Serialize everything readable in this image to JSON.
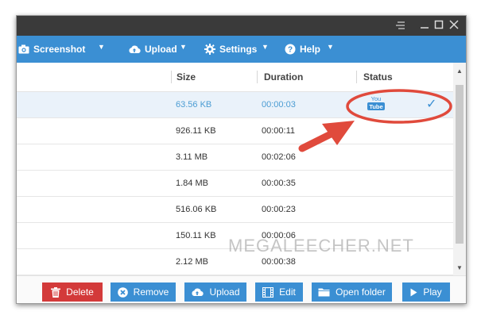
{
  "menubar": {
    "screenshot_label": "Screenshot",
    "upload_label": "Upload",
    "settings_label": "Settings",
    "help_label": "Help"
  },
  "table": {
    "headers": {
      "size": "Size",
      "duration": "Duration",
      "status": "Status"
    },
    "rows": [
      {
        "size": "63.56 KB",
        "duration": "00:00:03",
        "status_icon": "youtube-icon",
        "status_check": "✓"
      },
      {
        "size": "926.11 KB",
        "duration": "00:00:11"
      },
      {
        "size": "3.11 MB",
        "duration": "00:02:06"
      },
      {
        "size": "1.84 MB",
        "duration": "00:00:35"
      },
      {
        "size": "516.06 KB",
        "duration": "00:00:23"
      },
      {
        "size": "150.11 KB",
        "duration": "00:00:06"
      },
      {
        "size": "2.12 MB",
        "duration": "00:00:38"
      }
    ],
    "youtube_top": "You",
    "youtube_bottom": "Tube"
  },
  "buttons": {
    "delete": "Delete",
    "remove": "Remove",
    "upload": "Upload",
    "edit": "Edit",
    "open_folder": "Open folder",
    "play": "Play"
  },
  "watermark": "MEGALEECHER.NET",
  "colors": {
    "accent": "#3b8fd3",
    "delete": "#d33a3a",
    "annotation": "#e04a3c",
    "titlebar": "#3a3a3a"
  }
}
